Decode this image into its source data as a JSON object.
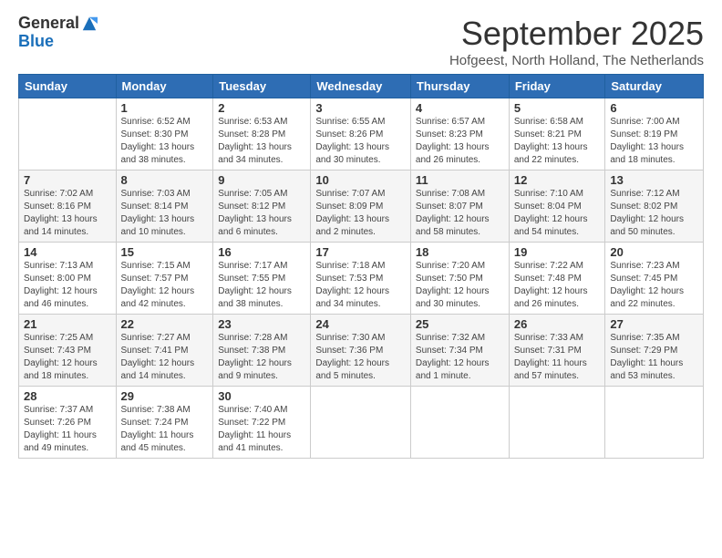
{
  "logo": {
    "general": "General",
    "blue": "Blue"
  },
  "header": {
    "month": "September 2025",
    "location": "Hofgeest, North Holland, The Netherlands"
  },
  "weekdays": [
    "Sunday",
    "Monday",
    "Tuesday",
    "Wednesday",
    "Thursday",
    "Friday",
    "Saturday"
  ],
  "weeks": [
    [
      {
        "day": "",
        "info": ""
      },
      {
        "day": "1",
        "info": "Sunrise: 6:52 AM\nSunset: 8:30 PM\nDaylight: 13 hours\nand 38 minutes."
      },
      {
        "day": "2",
        "info": "Sunrise: 6:53 AM\nSunset: 8:28 PM\nDaylight: 13 hours\nand 34 minutes."
      },
      {
        "day": "3",
        "info": "Sunrise: 6:55 AM\nSunset: 8:26 PM\nDaylight: 13 hours\nand 30 minutes."
      },
      {
        "day": "4",
        "info": "Sunrise: 6:57 AM\nSunset: 8:23 PM\nDaylight: 13 hours\nand 26 minutes."
      },
      {
        "day": "5",
        "info": "Sunrise: 6:58 AM\nSunset: 8:21 PM\nDaylight: 13 hours\nand 22 minutes."
      },
      {
        "day": "6",
        "info": "Sunrise: 7:00 AM\nSunset: 8:19 PM\nDaylight: 13 hours\nand 18 minutes."
      }
    ],
    [
      {
        "day": "7",
        "info": "Sunrise: 7:02 AM\nSunset: 8:16 PM\nDaylight: 13 hours\nand 14 minutes."
      },
      {
        "day": "8",
        "info": "Sunrise: 7:03 AM\nSunset: 8:14 PM\nDaylight: 13 hours\nand 10 minutes."
      },
      {
        "day": "9",
        "info": "Sunrise: 7:05 AM\nSunset: 8:12 PM\nDaylight: 13 hours\nand 6 minutes."
      },
      {
        "day": "10",
        "info": "Sunrise: 7:07 AM\nSunset: 8:09 PM\nDaylight: 13 hours\nand 2 minutes."
      },
      {
        "day": "11",
        "info": "Sunrise: 7:08 AM\nSunset: 8:07 PM\nDaylight: 12 hours\nand 58 minutes."
      },
      {
        "day": "12",
        "info": "Sunrise: 7:10 AM\nSunset: 8:04 PM\nDaylight: 12 hours\nand 54 minutes."
      },
      {
        "day": "13",
        "info": "Sunrise: 7:12 AM\nSunset: 8:02 PM\nDaylight: 12 hours\nand 50 minutes."
      }
    ],
    [
      {
        "day": "14",
        "info": "Sunrise: 7:13 AM\nSunset: 8:00 PM\nDaylight: 12 hours\nand 46 minutes."
      },
      {
        "day": "15",
        "info": "Sunrise: 7:15 AM\nSunset: 7:57 PM\nDaylight: 12 hours\nand 42 minutes."
      },
      {
        "day": "16",
        "info": "Sunrise: 7:17 AM\nSunset: 7:55 PM\nDaylight: 12 hours\nand 38 minutes."
      },
      {
        "day": "17",
        "info": "Sunrise: 7:18 AM\nSunset: 7:53 PM\nDaylight: 12 hours\nand 34 minutes."
      },
      {
        "day": "18",
        "info": "Sunrise: 7:20 AM\nSunset: 7:50 PM\nDaylight: 12 hours\nand 30 minutes."
      },
      {
        "day": "19",
        "info": "Sunrise: 7:22 AM\nSunset: 7:48 PM\nDaylight: 12 hours\nand 26 minutes."
      },
      {
        "day": "20",
        "info": "Sunrise: 7:23 AM\nSunset: 7:45 PM\nDaylight: 12 hours\nand 22 minutes."
      }
    ],
    [
      {
        "day": "21",
        "info": "Sunrise: 7:25 AM\nSunset: 7:43 PM\nDaylight: 12 hours\nand 18 minutes."
      },
      {
        "day": "22",
        "info": "Sunrise: 7:27 AM\nSunset: 7:41 PM\nDaylight: 12 hours\nand 14 minutes."
      },
      {
        "day": "23",
        "info": "Sunrise: 7:28 AM\nSunset: 7:38 PM\nDaylight: 12 hours\nand 9 minutes."
      },
      {
        "day": "24",
        "info": "Sunrise: 7:30 AM\nSunset: 7:36 PM\nDaylight: 12 hours\nand 5 minutes."
      },
      {
        "day": "25",
        "info": "Sunrise: 7:32 AM\nSunset: 7:34 PM\nDaylight: 12 hours\nand 1 minute."
      },
      {
        "day": "26",
        "info": "Sunrise: 7:33 AM\nSunset: 7:31 PM\nDaylight: 11 hours\nand 57 minutes."
      },
      {
        "day": "27",
        "info": "Sunrise: 7:35 AM\nSunset: 7:29 PM\nDaylight: 11 hours\nand 53 minutes."
      }
    ],
    [
      {
        "day": "28",
        "info": "Sunrise: 7:37 AM\nSunset: 7:26 PM\nDaylight: 11 hours\nand 49 minutes."
      },
      {
        "day": "29",
        "info": "Sunrise: 7:38 AM\nSunset: 7:24 PM\nDaylight: 11 hours\nand 45 minutes."
      },
      {
        "day": "30",
        "info": "Sunrise: 7:40 AM\nSunset: 7:22 PM\nDaylight: 11 hours\nand 41 minutes."
      },
      {
        "day": "",
        "info": ""
      },
      {
        "day": "",
        "info": ""
      },
      {
        "day": "",
        "info": ""
      },
      {
        "day": "",
        "info": ""
      }
    ]
  ]
}
